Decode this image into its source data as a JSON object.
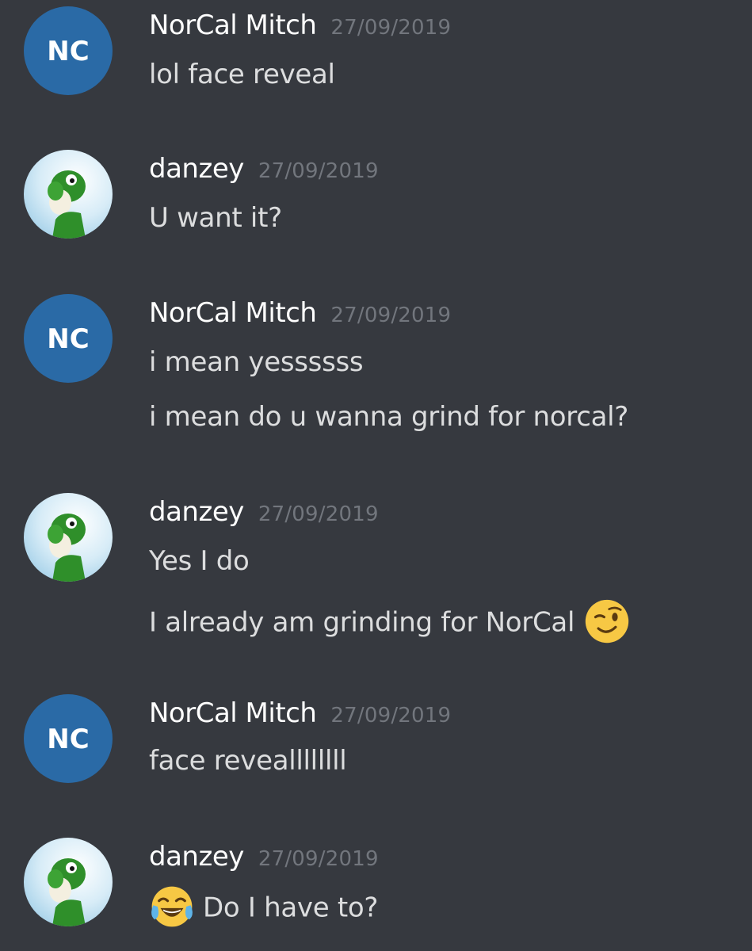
{
  "colors": {
    "background": "#36393f",
    "username": "#ffffff",
    "timestamp": "#72767d",
    "message_text": "#dcddde",
    "norcal_avatar_bg": "#2a6aa6",
    "emoji_face": "#f7c844"
  },
  "messages": [
    {
      "author": "NorCal Mitch",
      "avatar_icon": "norcal-logo-icon",
      "avatar_text": "NC",
      "timestamp": "27/09/2019",
      "lines": [
        "lol face reveal"
      ]
    },
    {
      "author": "danzey",
      "avatar_icon": "yoshi-avatar-icon",
      "timestamp": "27/09/2019",
      "lines": [
        "U want it?"
      ]
    },
    {
      "author": "NorCal Mitch",
      "avatar_icon": "norcal-logo-icon",
      "avatar_text": "NC",
      "timestamp": "27/09/2019",
      "lines": [
        "i mean yessssss",
        "i mean do u wanna grind for norcal?"
      ]
    },
    {
      "author": "danzey",
      "avatar_icon": "yoshi-avatar-icon",
      "timestamp": "27/09/2019",
      "lines": [
        "Yes I do",
        "I already am grinding for NorCal"
      ],
      "emoji": "winking-face-emoji"
    },
    {
      "author": "NorCal Mitch",
      "avatar_icon": "norcal-logo-icon",
      "avatar_text": "NC",
      "timestamp": "27/09/2019",
      "lines": [
        "face reveallllllll"
      ]
    },
    {
      "author": "danzey",
      "avatar_icon": "yoshi-avatar-icon",
      "timestamp": "27/09/2019",
      "lines": [
        "Do I have to?"
      ],
      "emoji": "tears-of-joy-emoji"
    }
  ]
}
